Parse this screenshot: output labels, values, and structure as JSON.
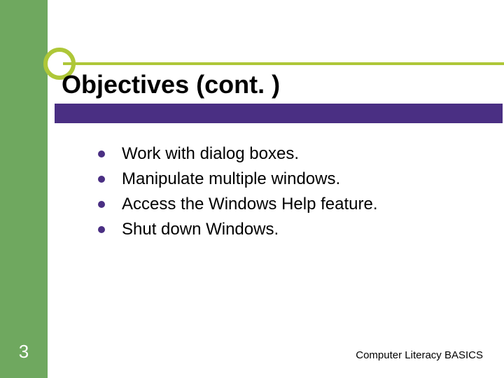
{
  "title": "Objectives (cont. )",
  "bullets": [
    "Work with dialog boxes.",
    "Manipulate multiple windows.",
    "Access the Windows Help feature.",
    "Shut down Windows."
  ],
  "page_number": "3",
  "footer": "Computer Literacy BASICS"
}
